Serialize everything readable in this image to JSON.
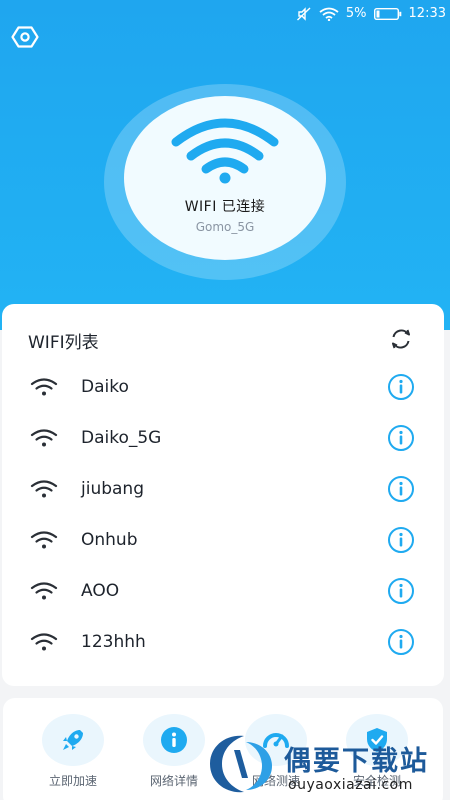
{
  "colors": {
    "primary": "#1fa6ef",
    "icon_blue": "#1faaf0",
    "text_dark": "#1d232c",
    "text_muted": "#8a95a3",
    "card_bg": "#ffffff",
    "page_bg": "#f3f4f6"
  },
  "status_bar": {
    "icons": [
      "mute-icon",
      "wifi-status-icon",
      "battery-icon"
    ],
    "battery_percent": "5%",
    "time": "12:33"
  },
  "hero": {
    "settings_icon": "hexagon-settings-icon",
    "status": "WIFI 已连接",
    "ssid": "Gomo_5G"
  },
  "wifi_card": {
    "title": "WIFI列表",
    "refresh_icon": "refresh-icon",
    "networks": [
      {
        "ssid": "Daiko",
        "icon": "wifi-signal-icon",
        "action_icon": "info-icon"
      },
      {
        "ssid": "Daiko_5G",
        "icon": "wifi-signal-icon",
        "action_icon": "info-icon"
      },
      {
        "ssid": "jiubang",
        "icon": "wifi-signal-icon",
        "action_icon": "info-icon"
      },
      {
        "ssid": "Onhub",
        "icon": "wifi-signal-icon",
        "action_icon": "info-icon"
      },
      {
        "ssid": "AOO",
        "icon": "wifi-signal-icon",
        "action_icon": "info-icon"
      },
      {
        "ssid": "123hhh",
        "icon": "wifi-signal-icon",
        "action_icon": "info-icon"
      }
    ]
  },
  "tools": [
    {
      "label": "立即加速",
      "icon": "rocket-icon"
    },
    {
      "label": "网络详情",
      "icon": "info-icon"
    },
    {
      "label": "网络测速",
      "icon": "speed-icon"
    },
    {
      "label": "安全检测",
      "icon": "shield-check-icon"
    }
  ],
  "watermark": {
    "title": "偶要下载站",
    "url": "ouyaoxiazai.com"
  }
}
